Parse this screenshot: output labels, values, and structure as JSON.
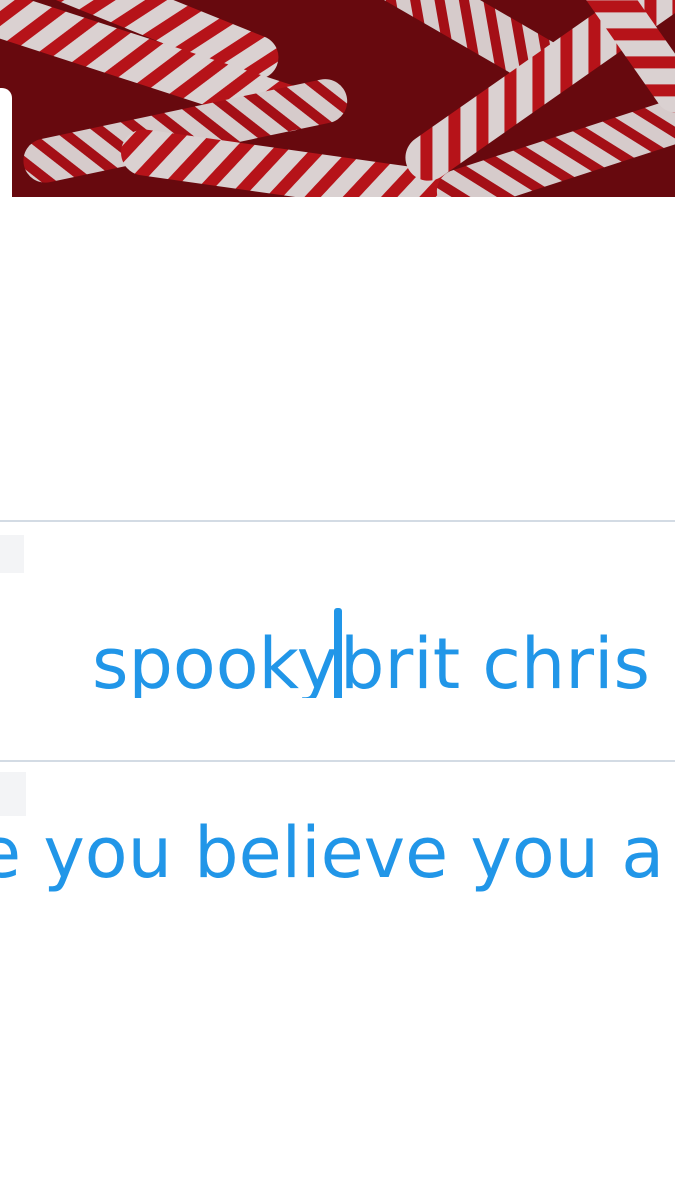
{
  "header_image": {
    "subject": "candy canes photo",
    "colors": [
      "#c4161c",
      "#f3f1f1",
      "#7a0d12"
    ]
  },
  "rows": [
    {
      "before_cursor": "spooky",
      "after_cursor": "brit chris"
    },
    {
      "text": "e you believe you a"
    }
  ],
  "accent_color": "#2196e8",
  "divider_color": "#d3dbe4"
}
